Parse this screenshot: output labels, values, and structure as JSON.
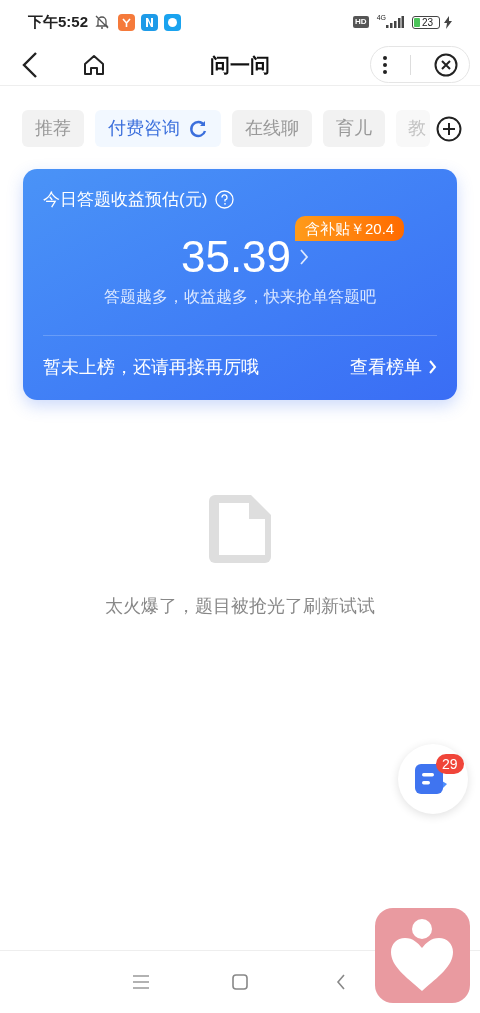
{
  "status_bar": {
    "time": "下午5:52",
    "hd": "HD",
    "network": "4G",
    "battery": "23"
  },
  "header": {
    "title": "问一问"
  },
  "tabs": [
    {
      "label": "推荐",
      "selected": false,
      "refresh": false,
      "faded": false
    },
    {
      "label": "付费咨询",
      "selected": true,
      "refresh": true,
      "faded": false
    },
    {
      "label": "在线聊",
      "selected": false,
      "refresh": false,
      "faded": false
    },
    {
      "label": "育儿",
      "selected": false,
      "refresh": false,
      "faded": false
    },
    {
      "label": "教",
      "selected": false,
      "refresh": false,
      "faded": true
    }
  ],
  "earnings_card": {
    "title": "今日答题收益预估(元)",
    "subsidy": "含补贴￥20.4",
    "amount": "35.39",
    "hint": "答题越多，收益越多，快来抢单答题吧",
    "rank_status": "暂未上榜，还请再接再厉哦",
    "rank_link": "查看榜单"
  },
  "empty_state": {
    "message": "太火爆了，题目被抢光了刷新试试"
  },
  "float_button": {
    "badge": "29"
  }
}
